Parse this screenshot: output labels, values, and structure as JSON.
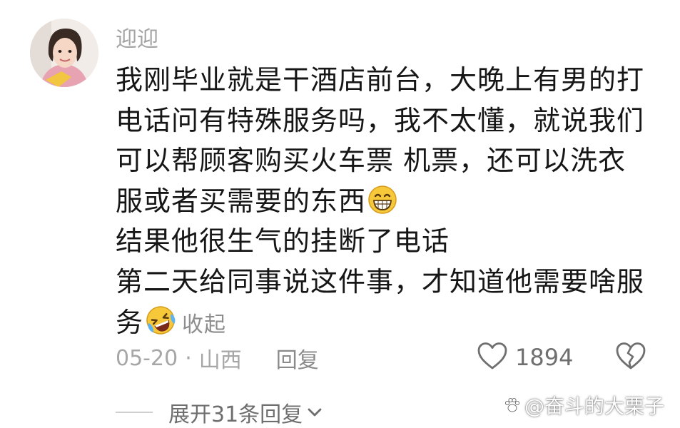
{
  "comment": {
    "username": "迎迎",
    "lines": [
      "我刚毕业就是干酒店前台，大晚上有男的打",
      "电话问有特殊服务吗，我不太懂，就说我们",
      "可以帮顾客购买火车票 机票，还可以洗衣",
      "服或者买需要的东西",
      "结果他很生气的挂断了电话",
      "第二天给同事说这件事，才知道他需要啥服",
      "务"
    ],
    "emoji_1": "grinning-face",
    "emoji_2": "rolling-on-floor-laughing-face",
    "collapse_label": "收起",
    "date": "05-20",
    "separator": "·",
    "location": "山西",
    "reply_label": "回复",
    "like_count": "1894",
    "expand_label": "展开31条回复"
  },
  "watermark": {
    "text": "@奋斗的大栗子"
  },
  "colors": {
    "text": "#161616",
    "meta": "#a6a6a6",
    "background": "#ffffff"
  }
}
